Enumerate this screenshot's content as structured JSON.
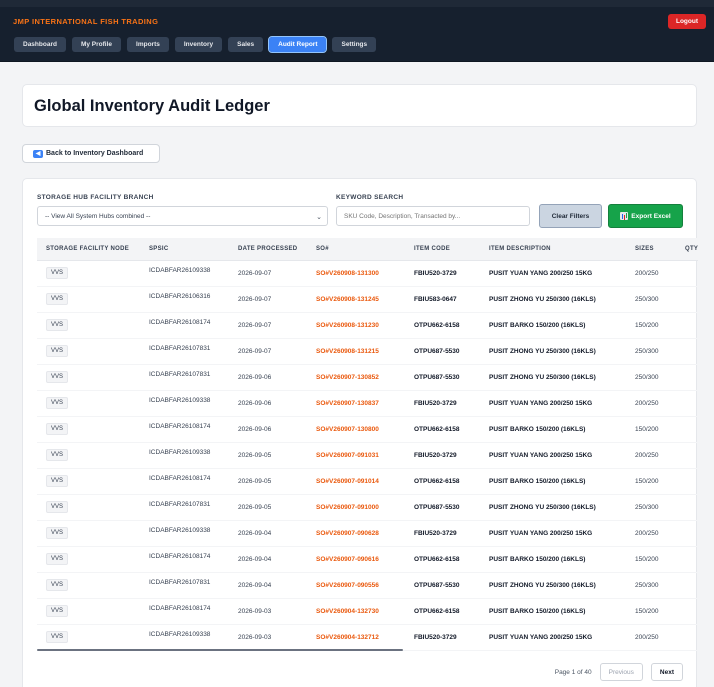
{
  "app": {
    "brand": "JMP INTERNATIONAL FISH TRADING",
    "logout_label": "Logout"
  },
  "nav": {
    "items": [
      {
        "label": "Dashboard",
        "active": false
      },
      {
        "label": "My Profile",
        "active": false
      },
      {
        "label": "Imports",
        "active": false
      },
      {
        "label": "Inventory",
        "active": false
      },
      {
        "label": "Sales",
        "active": false
      },
      {
        "label": "Audit Report",
        "active": true
      },
      {
        "label": "Settings",
        "active": false
      }
    ]
  },
  "page": {
    "title": "Global Inventory Audit Ledger",
    "back_label": "Back to Inventory Dashboard"
  },
  "filters": {
    "branch_label": "STORAGE HUB FACILITY BRANCH",
    "branch_selected": "-- View All System Hubs combined --",
    "keyword_label": "KEYWORD SEARCH",
    "keyword_placeholder": "SKU Code, Description, Transacted by...",
    "clear_label": "Clear Filters",
    "export_label": "Export Excel"
  },
  "table": {
    "columns": [
      "STORAGE FACILITY NODE",
      "SPSIC",
      "DATE PROCESSED",
      "SO#",
      "ITEM CODE",
      "ITEM DESCRIPTION",
      "SIZES",
      "QTY"
    ],
    "rows": [
      [
        "VVS",
        "ICDABFAR26109338",
        "2026-09-07",
        "SO#V260908-131300",
        "FBIU520-3729",
        "PUSIT YUAN YANG 200/250 15KG",
        "200/250"
      ],
      [
        "VVS",
        "ICDABFAR26106316",
        "2026-09-07",
        "SO#V260908-131245",
        "FBIU583-0647",
        "PUSIT ZHONG YU 250/300 (16KLS)",
        "250/300"
      ],
      [
        "VVS",
        "ICDABFAR26108174",
        "2026-09-07",
        "SO#V260908-131230",
        "OTPU662-6158",
        "PUSIT BARKO 150/200 (16KLS)",
        "150/200"
      ],
      [
        "VVS",
        "ICDABFAR26107831",
        "2026-09-07",
        "SO#V260908-131215",
        "OTPU687-5530",
        "PUSIT ZHONG YU 250/300 (16KLS)",
        "250/300"
      ],
      [
        "VVS",
        "ICDABFAR26107831",
        "2026-09-06",
        "SO#V260907-130852",
        "OTPU687-5530",
        "PUSIT ZHONG YU 250/300 (16KLS)",
        "250/300"
      ],
      [
        "VVS",
        "ICDABFAR26109338",
        "2026-09-06",
        "SO#V260907-130837",
        "FBIU520-3729",
        "PUSIT YUAN YANG 200/250 15KG",
        "200/250"
      ],
      [
        "VVS",
        "ICDABFAR26108174",
        "2026-09-06",
        "SO#V260907-130800",
        "OTPU662-6158",
        "PUSIT BARKO 150/200 (16KLS)",
        "150/200"
      ],
      [
        "VVS",
        "ICDABFAR26109338",
        "2026-09-05",
        "SO#V260907-091031",
        "FBIU520-3729",
        "PUSIT YUAN YANG 200/250 15KG",
        "200/250"
      ],
      [
        "VVS",
        "ICDABFAR26108174",
        "2026-09-05",
        "SO#V260907-091014",
        "OTPU662-6158",
        "PUSIT BARKO 150/200 (16KLS)",
        "150/200"
      ],
      [
        "VVS",
        "ICDABFAR26107831",
        "2026-09-05",
        "SO#V260907-091000",
        "OTPU687-5530",
        "PUSIT ZHONG YU 250/300 (16KLS)",
        "250/300"
      ],
      [
        "VVS",
        "ICDABFAR26109338",
        "2026-09-04",
        "SO#V260907-090628",
        "FBIU520-3729",
        "PUSIT YUAN YANG 200/250 15KG",
        "200/250"
      ],
      [
        "VVS",
        "ICDABFAR26108174",
        "2026-09-04",
        "SO#V260907-090616",
        "OTPU662-6158",
        "PUSIT BARKO 150/200 (16KLS)",
        "150/200"
      ],
      [
        "VVS",
        "ICDABFAR26107831",
        "2026-09-04",
        "SO#V260907-090556",
        "OTPU687-5530",
        "PUSIT ZHONG YU 250/300 (16KLS)",
        "250/300"
      ],
      [
        "VVS",
        "ICDABFAR26108174",
        "2026-09-03",
        "SO#V260904-132730",
        "OTPU662-6158",
        "PUSIT BARKO 150/200 (16KLS)",
        "150/200"
      ],
      [
        "VVS",
        "ICDABFAR26109338",
        "2026-09-03",
        "SO#V260904-132712",
        "FBIU520-3729",
        "PUSIT YUAN YANG 200/250 15KG",
        "200/250"
      ]
    ]
  },
  "pagination": {
    "info": "Page 1 of 40",
    "prev_label": "Previous",
    "next_label": "Next"
  },
  "colors": {
    "brand": "#f97316",
    "nav_bg": "#16202e",
    "active_tab": "#3b82f6",
    "logout": "#dc2626",
    "export": "#16a34a",
    "so_link": "#ea580c"
  },
  "icons": {
    "back": "back-arrow-icon",
    "export": "excel-chart-icon",
    "select": "chevron-down-icon"
  }
}
